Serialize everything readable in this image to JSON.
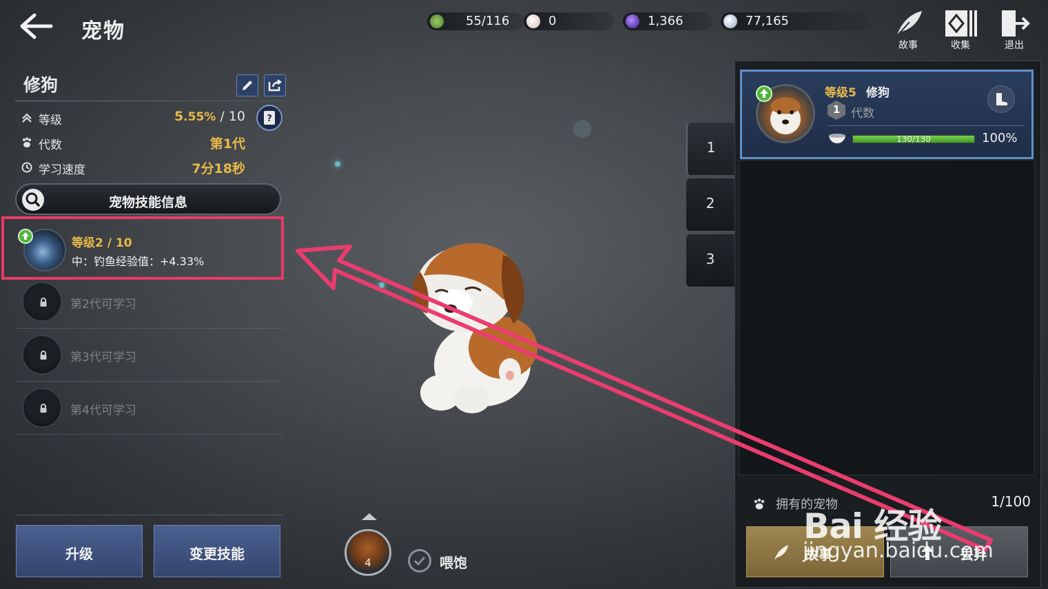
{
  "header": {
    "title": "宠物",
    "resources": [
      {
        "icon": "green-leaf-coin-icon",
        "value": "55/116",
        "color": "#6fae3e"
      },
      {
        "icon": "pearl-icon",
        "value": "0",
        "color": "#e6d2cc"
      },
      {
        "icon": "purple-gem-icon",
        "value": "1,366",
        "color": "#7a3fd0"
      },
      {
        "icon": "silver-coin-icon",
        "value": "77,165",
        "color": "#c9d6e6"
      }
    ],
    "actions": [
      {
        "icon": "feather-icon",
        "label": "故事"
      },
      {
        "icon": "collection-icon",
        "label": "收集"
      },
      {
        "icon": "exit-icon",
        "label": "退出"
      }
    ]
  },
  "pet": {
    "name": "修狗",
    "stats": [
      {
        "icon": "level-chevron-icon",
        "label": "等级",
        "value_main": "5",
        "value_pct": ".55%",
        "value_max": " / 10"
      },
      {
        "icon": "paw-icon",
        "label": "代数",
        "value": "第1代"
      },
      {
        "icon": "clock-icon",
        "label": "学习速度",
        "value": "7分18秒"
      }
    ],
    "skill_info_button": "宠物技能信息"
  },
  "skills": {
    "active": {
      "level": "等级2 / 10",
      "desc": "中：钓鱼经验值：+4.33%"
    },
    "locked": [
      "第2代可学习",
      "第3代可学习",
      "第4代可学习"
    ]
  },
  "left_actions": {
    "upgrade": "升级",
    "change_skill": "变更技能"
  },
  "feeding": {
    "count": "4",
    "label": "喂饱"
  },
  "slots": [
    "1",
    "2",
    "3"
  ],
  "pet_card": {
    "level": "等级5",
    "name": "修狗",
    "generation": "1",
    "generation_label": "代数",
    "satiety": "130/130",
    "satiety_fraction": 1.0,
    "percent": "100%"
  },
  "owned": {
    "label": "拥有的宠物",
    "count": "1/100"
  },
  "right_actions": {
    "story": "故事",
    "release": "丢弃"
  },
  "watermark": {
    "logo": "Bai 经验",
    "url": "jingyan.baidu.com"
  },
  "colors": {
    "accent_gold": "#e8b94a",
    "highlight": "#e93a6b",
    "card_border": "#6390c8",
    "progress": "#5ab83a"
  }
}
